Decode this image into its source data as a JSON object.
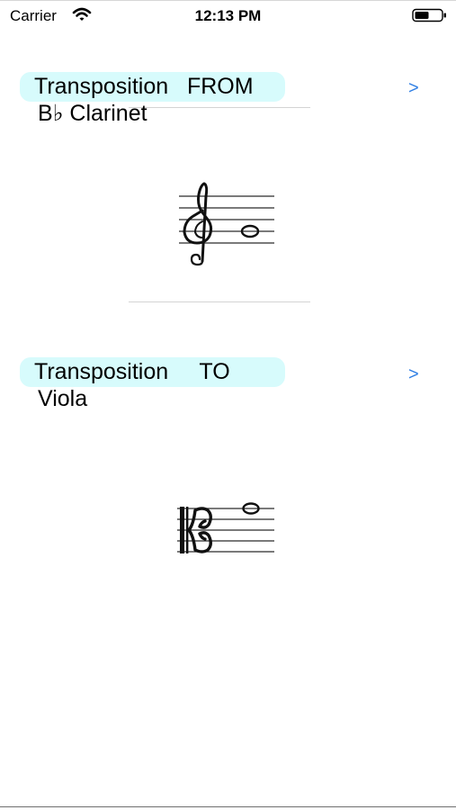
{
  "status_bar": {
    "carrier": "Carrier",
    "time": "12:13 PM"
  },
  "from_section": {
    "heading": "Transposition   FROM",
    "chevron": ">",
    "instrument": "B♭ Clarinet",
    "clef": "treble-clef-icon"
  },
  "to_section": {
    "heading": "Transposition     TO",
    "chevron": ">",
    "instrument": "Viola",
    "clef": "alto-clef-icon"
  },
  "colors": {
    "pill_background": "#d7fbfc",
    "accent": "#2f7fe4"
  }
}
